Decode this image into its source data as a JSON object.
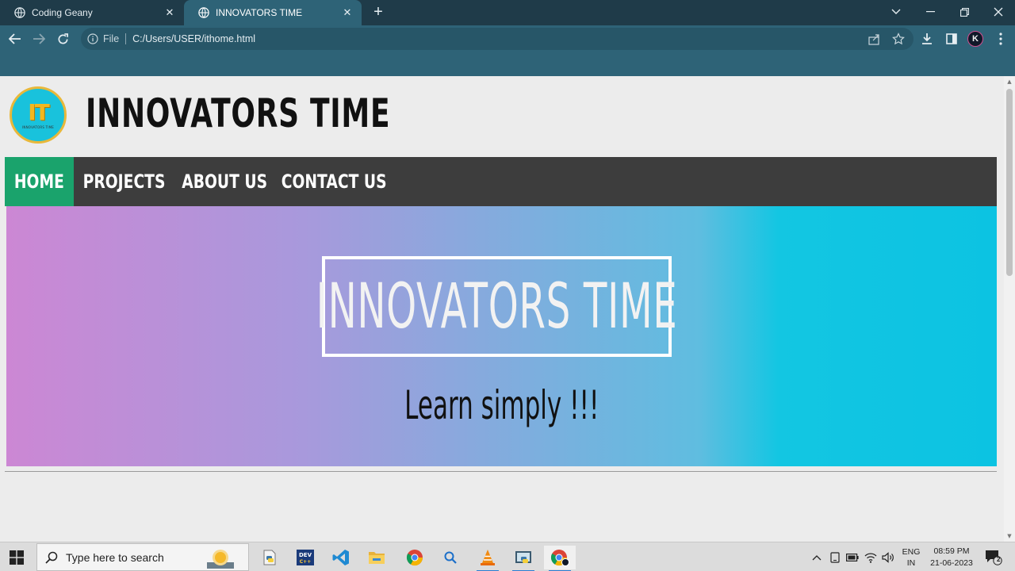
{
  "browser": {
    "tabs": [
      {
        "label": "Coding Geany",
        "active": false
      },
      {
        "label": "INNOVATORS TIME",
        "active": true
      }
    ],
    "new_tab": "+",
    "address": {
      "scheme_label": "File",
      "url": "C:/Users/USER/ithome.html"
    },
    "profile_initial": "K"
  },
  "page": {
    "logo": {
      "initials": "IT",
      "caption": "INNOVATORS TIME"
    },
    "site_title": "INNOVATORS TIME",
    "nav": [
      {
        "label": "HOME",
        "active": true
      },
      {
        "label": "PROJECTS",
        "active": false
      },
      {
        "label": "ABOUT US",
        "active": false
      },
      {
        "label": "CONTACT US",
        "active": false
      }
    ],
    "hero": {
      "title": "INNOVATORS TIME",
      "tagline": "Learn simply !!!"
    }
  },
  "taskbar": {
    "search_placeholder": "Type here to search",
    "apps": [
      "python-idle",
      "dev-cpp",
      "vscode",
      "file-explorer",
      "chrome",
      "search",
      "vlc",
      "python-editor",
      "chrome-profile"
    ],
    "language": {
      "line1": "ENG",
      "line2": "IN"
    },
    "clock": {
      "time": "08:59 PM",
      "date": "21-06-2023"
    },
    "notification_count": "2"
  },
  "colors": {
    "tab_strip": "#1f3b49",
    "toolbar": "#2e6377",
    "nav_bg": "#3d3d3d",
    "nav_active": "#1aa36c",
    "hero_gradient_start": "#cc87d4",
    "hero_gradient_end": "#0cc3e2"
  }
}
